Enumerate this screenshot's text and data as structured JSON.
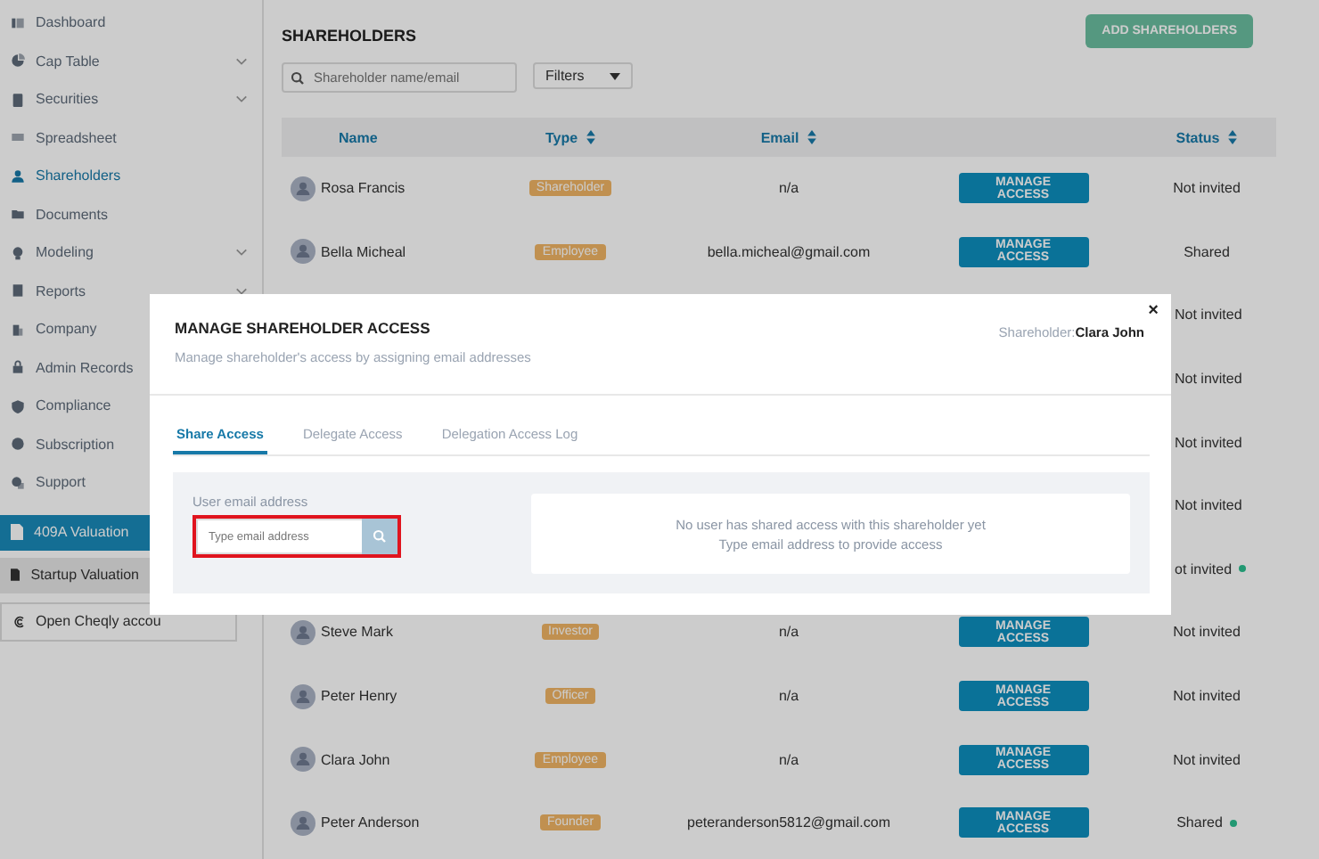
{
  "sidebar": {
    "items": [
      {
        "label": "Dashboard",
        "selected": false,
        "expandable": false
      },
      {
        "label": "Cap Table",
        "selected": false,
        "expandable": true
      },
      {
        "label": "Securities",
        "selected": false,
        "expandable": true
      },
      {
        "label": "Spreadsheet",
        "selected": false,
        "expandable": false
      },
      {
        "label": "Shareholders",
        "selected": true,
        "expandable": false
      },
      {
        "label": "Documents",
        "selected": false,
        "expandable": false
      },
      {
        "label": "Modeling",
        "selected": false,
        "expandable": true
      },
      {
        "label": "Reports",
        "selected": false,
        "expandable": true
      },
      {
        "label": "Company",
        "selected": false,
        "expandable": false
      },
      {
        "label": "Admin Records",
        "selected": false,
        "expandable": false
      },
      {
        "label": "Compliance",
        "selected": false,
        "expandable": false
      },
      {
        "label": "Subscription",
        "selected": false,
        "expandable": false
      },
      {
        "label": "Support",
        "selected": false,
        "expandable": false
      }
    ],
    "valuation_links": [
      {
        "label": "409A Valuation",
        "highlighted": true
      },
      {
        "label": "Startup Valuation",
        "highlighted": false
      }
    ],
    "account_link": {
      "label": "Open Cheqly accou"
    }
  },
  "header": {
    "title": "SHAREHOLDERS",
    "add_button": "ADD SHAREHOLDERS"
  },
  "search": {
    "placeholder": "Shareholder name/email"
  },
  "filters": {
    "label": "Filters"
  },
  "table": {
    "columns": [
      "Name",
      "Type",
      "Email",
      "Status"
    ],
    "rows": [
      {
        "kind": "row",
        "name": "Rosa Francis",
        "type": "Shareholder",
        "email": "n/a",
        "action": "MANAGE ACCESS",
        "status": "Not invited",
        "indicator": false
      },
      {
        "kind": "row",
        "name": "Bella Micheal",
        "type": "Employee",
        "email": "bella.micheal@gmail.com",
        "action": "MANAGE ACCESS",
        "status": "Shared",
        "indicator": false
      },
      {
        "kind": "covered",
        "status": "Not invited",
        "indicator": false
      },
      {
        "kind": "covered",
        "status": "Not invited",
        "indicator": false
      },
      {
        "kind": "covered",
        "status": "Not invited",
        "indicator": false
      },
      {
        "kind": "covered",
        "status": "Not invited",
        "indicator": false
      },
      {
        "kind": "covered",
        "status": "ot invited",
        "indicator": true
      },
      {
        "kind": "row",
        "name": "Steve Mark",
        "type": "Investor",
        "email": "n/a",
        "action": "MANAGE ACCESS",
        "status": "Not invited",
        "indicator": false
      },
      {
        "kind": "row",
        "name": "Peter Henry",
        "type": "Officer",
        "email": "n/a",
        "action": "MANAGE ACCESS",
        "status": "Not invited",
        "indicator": false
      },
      {
        "kind": "row",
        "name": "Clara John",
        "type": "Employee",
        "email": "n/a",
        "action": "MANAGE ACCESS",
        "status": "Not invited",
        "indicator": false
      },
      {
        "kind": "row",
        "name": "Peter Anderson",
        "type": "Founder",
        "email": "peteranderson5812@gmail.com",
        "action": "MANAGE ACCESS",
        "status": "Shared",
        "indicator": true
      }
    ]
  },
  "dialog": {
    "title": "MANAGE SHAREHOLDER ACCESS",
    "subtitle": "Manage shareholder's access by assigning email addresses",
    "shareholder_label": "Shareholder:",
    "shareholder_name": "Clara John",
    "close": "×",
    "tabs": [
      {
        "label": "Share Access",
        "selected": true
      },
      {
        "label": "Delegate Access",
        "selected": false
      },
      {
        "label": "Delegation Access Log",
        "selected": false
      }
    ],
    "email_field": {
      "label": "User email address",
      "placeholder": "Type email address",
      "highlighted": true
    },
    "empty_message": [
      "No user has shared access with this shareholder yet",
      "Type email address to provide access"
    ]
  }
}
